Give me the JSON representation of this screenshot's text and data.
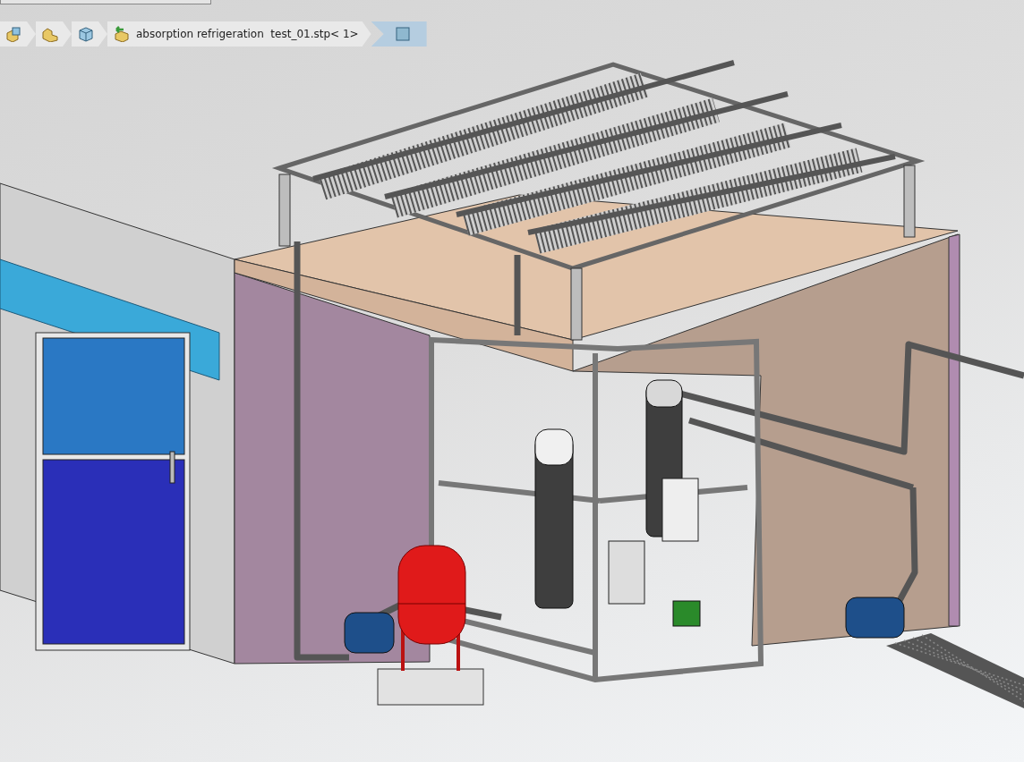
{
  "breadcrumb": {
    "items": [
      {
        "kind": "assembly",
        "selected": false
      },
      {
        "kind": "component",
        "selected": false
      },
      {
        "kind": "part",
        "selected": false
      },
      {
        "kind": "subassembly",
        "label": "absorption refrigeration  test_01.stp< 1>",
        "selected": false
      },
      {
        "kind": "body",
        "selected": true
      }
    ]
  }
}
